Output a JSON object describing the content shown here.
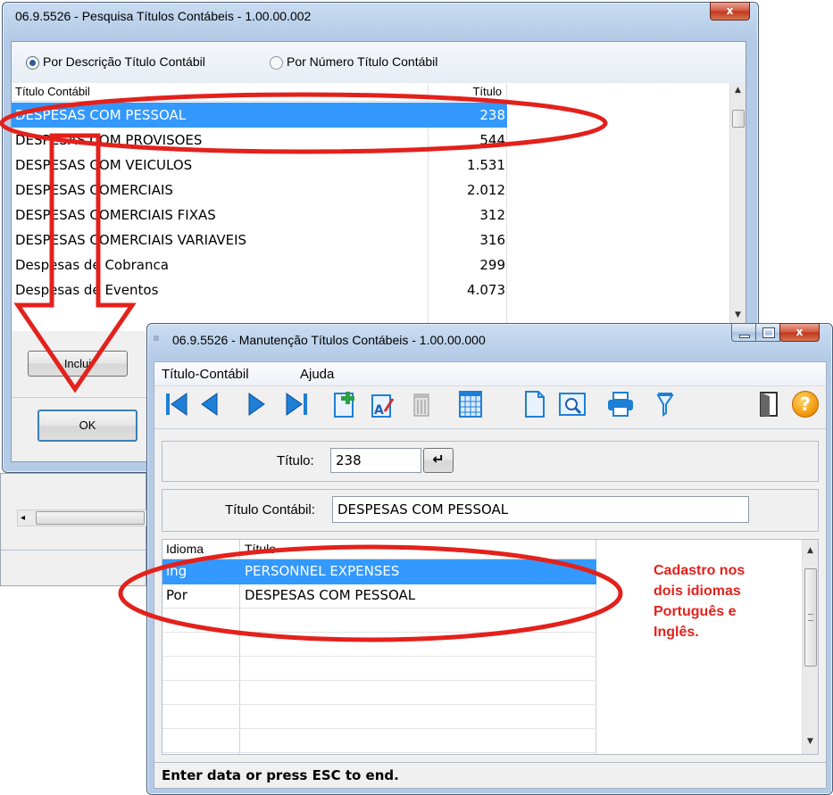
{
  "search_window": {
    "title": "06.9.5526 - Pesquisa Títulos Contábeis - 1.00.00.002",
    "close_glyph": "x",
    "radio_options": [
      {
        "label": "Por Descrição Título Contábil",
        "selected": true
      },
      {
        "label": "Por Número Título Contábil",
        "selected": false
      }
    ],
    "columns": {
      "description": "Título Contábil",
      "number": "Título"
    },
    "rows": [
      {
        "description": "DESPESAS COM PESSOAL",
        "number": "238"
      },
      {
        "description": "DESPESAS COM PROVISOES",
        "number": "544"
      },
      {
        "description": "DESPESAS COM VEICULOS",
        "number": "1.531"
      },
      {
        "description": "DESPESAS COMERCIAIS",
        "number": "2.012"
      },
      {
        "description": "DESPESAS COMERCIAIS FIXAS",
        "number": "312"
      },
      {
        "description": "DESPESAS COMERCIAIS VARIAVEIS",
        "number": "316"
      },
      {
        "description": "Despesas de Cobranca",
        "number": "299"
      },
      {
        "description": "Despesas de Eventos",
        "number": "4.073"
      }
    ],
    "include_button": "Inclui",
    "ok_button": "OK"
  },
  "maint_window": {
    "title": "06.9.5526 - Manutenção Títulos Contábeis - 1.00.00.000",
    "close_glyph": "x",
    "menu": [
      "Título-Contábil",
      "Ajuda"
    ],
    "toolbar_icons": [
      "first-icon",
      "previous-icon",
      "next-icon",
      "last-icon",
      "add-icon",
      "edit-icon",
      "delete-icon",
      "calendar-grid-icon",
      "document-icon",
      "preview-icon",
      "print-icon",
      "filter-icon",
      "exit-door-icon",
      "help-icon"
    ],
    "titulo_label": "Título:",
    "titulo_value": "238",
    "enter_glyph": "↵",
    "titulo_contabil_label": "Título Contábil:",
    "titulo_contabil_value": "DESPESAS COM PESSOAL",
    "lang_columns": {
      "idioma": "Idioma",
      "titulo": "Título"
    },
    "lang_rows": [
      {
        "idioma": "ing",
        "titulo": "PERSONNEL EXPENSES"
      },
      {
        "idioma": "Por",
        "titulo": "DESPESAS COM PESSOAL"
      }
    ],
    "status": "Enter data or press ESC to end.",
    "help_glyph": "?"
  },
  "annotation": {
    "lines": [
      "Cadastro nos",
      "dois idiomas",
      "Português e",
      "Inglês."
    ],
    "color": "#e3211c"
  },
  "colors": {
    "selection": "#3399ff",
    "annotation_red": "#e3211c"
  }
}
